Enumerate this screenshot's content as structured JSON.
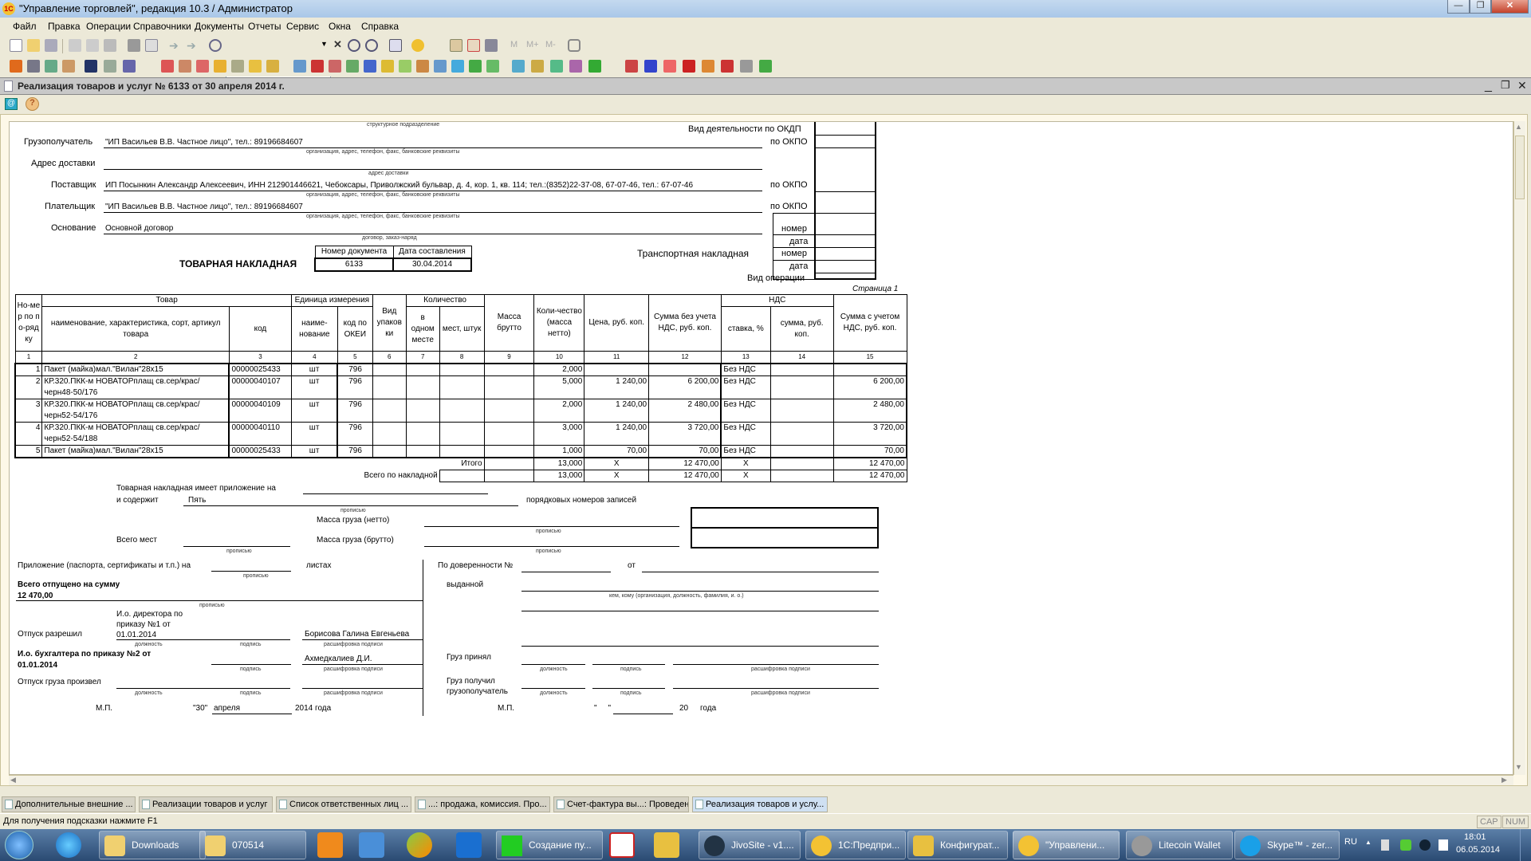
{
  "window": {
    "title": "\"Управление торговлей\", редакция 10.3 / Администратор",
    "controls": [
      "minimize",
      "restore",
      "close"
    ]
  },
  "menu": [
    "Файл",
    "Правка",
    "Операции",
    "Справочники",
    "Документы",
    "Отчеты",
    "Сервис",
    "Окна",
    "Справка"
  ],
  "toolbar": {
    "search_value": "",
    "m_buttons": [
      "M",
      "M+",
      "M-"
    ]
  },
  "document": {
    "title": "Реализация товаров и услуг № 6133 от 30 апреля 2014 г.",
    "header": {
      "struct_unit_caption": "структурное подразделение",
      "okdp_label": "Вид деятельности по ОКДП",
      "okpo_label": "по ОКПО",
      "consignee_label": "Грузополучатель",
      "consignee_value": "\"ИП Васильев В.В. Частное лицо\", тел.: 89196684607",
      "org_caption": "организация, адрес, телефон, факс, банковские реквизиты",
      "delivery_label": "Адрес доставки",
      "delivery_value": "",
      "delivery_caption": "адрес доставки",
      "supplier_label": "Поставщик",
      "supplier_value": "ИП Посынкин Александр Алексеевич, ИНН 212901446621, Чебоксары, Приволжский бульвар, д. 4, кор. 1, кв. 114; тел.:(8352)22-37-08, 67-07-46, тел.: 67-07-46",
      "payer_label": "Плательщик",
      "payer_value": "\"ИП Васильев В.В. Частное лицо\", тел.: 89196684607",
      "basis_label": "Основание",
      "basis_value": "Основной договор",
      "basis_caption": "договор, заказ-наряд",
      "number_label": "номер",
      "date_label": "дата",
      "transport_label": "Транспортная накладная",
      "operation_label": "Вид операции",
      "form_title": "ТОВАРНАЯ НАКЛАДНАЯ",
      "doc_number_header": "Номер документа",
      "doc_date_header": "Дата составления",
      "doc_number": "6133",
      "doc_date": "30.04.2014",
      "page_label": "Страница 1"
    },
    "table": {
      "headers": {
        "num": "Но-мер по по-рядку",
        "goods": "Товар",
        "goods_name": "наименование, характеристика, сорт, артикул товара",
        "goods_code": "код",
        "unit": "Единица измерения",
        "unit_name": "наиме-нование",
        "unit_okei": "код по ОКЕИ",
        "pack_type": "Вид упаков ки",
        "qty": "Количество",
        "qty_in_place": "в одном месте",
        "qty_places": "мест, штук",
        "mass_gross": "Масса брутто",
        "qty_net": "Коли-чество (масса нетто)",
        "price": "Цена, руб. коп.",
        "sum_no_vat": "Сумма без учета НДС, руб. коп.",
        "vat": "НДС",
        "vat_rate": "ставка, %",
        "vat_sum": "сумма, руб. коп.",
        "sum_with_vat": "Сумма с учетом НДС, руб. коп."
      },
      "col_numbers": [
        "1",
        "2",
        "3",
        "4",
        "5",
        "6",
        "7",
        "8",
        "9",
        "10",
        "11",
        "12",
        "13",
        "14",
        "15"
      ],
      "rows": [
        {
          "n": "1",
          "name": "Пакет (майка)мал.\"Вилан\"28х15",
          "code": "00000025433",
          "unit": "шт",
          "okei": "796",
          "qty": "2,000",
          "price": "",
          "sum": "",
          "vat_rate": "Без НДС",
          "vat_sum": "",
          "total": ""
        },
        {
          "n": "2",
          "name": "КР.320.ПКК-м НОВАТОРплащ св.сер/крас/черн48-50/176",
          "code": "00000040107",
          "unit": "шт",
          "okei": "796",
          "qty": "5,000",
          "price": "1 240,00",
          "sum": "6 200,00",
          "vat_rate": "Без НДС",
          "vat_sum": "",
          "total": "6 200,00"
        },
        {
          "n": "3",
          "name": "КР.320.ПКК-м НОВАТОРплащ св.сер/крас/черн52-54/176",
          "code": "00000040109",
          "unit": "шт",
          "okei": "796",
          "qty": "2,000",
          "price": "1 240,00",
          "sum": "2 480,00",
          "vat_rate": "Без НДС",
          "vat_sum": "",
          "total": "2 480,00"
        },
        {
          "n": "4",
          "name": "КР.320.ПКК-м НОВАТОРплащ св.сер/крас/черн52-54/188",
          "code": "00000040110",
          "unit": "шт",
          "okei": "796",
          "qty": "3,000",
          "price": "1 240,00",
          "sum": "3 720,00",
          "vat_rate": "Без НДС",
          "vat_sum": "",
          "total": "3 720,00"
        },
        {
          "n": "5",
          "name": "Пакет (майка)мал.\"Вилан\"28х15",
          "code": "00000025433",
          "unit": "шт",
          "okei": "796",
          "qty": "1,000",
          "price": "70,00",
          "sum": "70,00",
          "vat_rate": "Без НДС",
          "vat_sum": "",
          "total": "70,00"
        }
      ],
      "itogo": {
        "label": "Итого",
        "qty": "13,000",
        "price": "X",
        "sum": "12 470,00",
        "vat_rate": "X",
        "total": "12 470,00"
      },
      "vsego": {
        "label": "Всего по накладной",
        "qty": "13,000",
        "price": "X",
        "sum": "12 470,00",
        "vat_rate": "X",
        "total": "12 470,00"
      }
    },
    "footer": {
      "attachment_label": "Товарная накладная имеет приложение на",
      "contains_label": "и содержит",
      "contains_value": "Пять",
      "records_label": "порядковых номеров записей",
      "propisyu": "прописью",
      "mass_net_label": "Масса груза (нетто)",
      "mass_gross_label": "Масса груза (брутто)",
      "places_label": "Всего мест",
      "appendix_label": "Приложение (паспорта, сертификаты и т.п.) на",
      "sheets_label": "листах",
      "released_sum_label": "Всего отпущено  на сумму",
      "released_sum_value": "12 470,00",
      "release_allowed_label": "Отпуск разрешил",
      "release_allowed_position": "И.о. директора по приказу №1 от 01.01.2014",
      "release_allowed_name": "Борисова Галина Евгеньева",
      "accountant_label": "И.о. бухгалтера по приказу №2 от 01.01.2014",
      "accountant_name": "Ахмедкалиев Д.И.",
      "cargo_released_label": "Отпуск груза произвел",
      "position_caption": "должность",
      "signature_caption": "подпись",
      "decode_caption": "расшифровка подписи",
      "mp_label": "М.П.",
      "date_day": "\"30\"",
      "date_month": "апреля",
      "date_year": "2014 года",
      "proxy_label": "По доверенности №",
      "from_label": "от",
      "issued_label": "выданной",
      "issued_caption": "кем, кому (организация, должность, фамилия, и. о.)",
      "cargo_accepted_label": "Груз принял",
      "cargo_received_label": "Груз получил грузополучатель",
      "mp2_label": "М.П.",
      "date2_quotes": "\"     \"",
      "date2_year": "20",
      "date2_suffix": "года"
    }
  },
  "window_tabs": [
    {
      "label": "Дополнительные внешние ...",
      "active": false
    },
    {
      "label": "Реализации товаров и услуг",
      "active": false
    },
    {
      "label": "Список ответственных лиц ...",
      "active": false
    },
    {
      "label": "...: продажа, комиссия. Про...",
      "active": false
    },
    {
      "label": "Счет-фактура вы...: Проведен",
      "active": false
    },
    {
      "label": "Реализация товаров и услу...",
      "active": true
    }
  ],
  "status": {
    "hint": "Для получения подсказки нажмите F1",
    "cap": "CAP",
    "num": "NUM"
  },
  "taskbar": {
    "buttons": [
      "Downloads",
      "070514",
      "Создание пу...",
      "JivoSite - v1....",
      "1С:Предпри...",
      "Конфигурат...",
      "\"Управлени...",
      "Litecoin Wallet",
      "Skype™ - zer..."
    ],
    "lang": "RU",
    "time": "18:01",
    "date": "06.05.2014"
  }
}
